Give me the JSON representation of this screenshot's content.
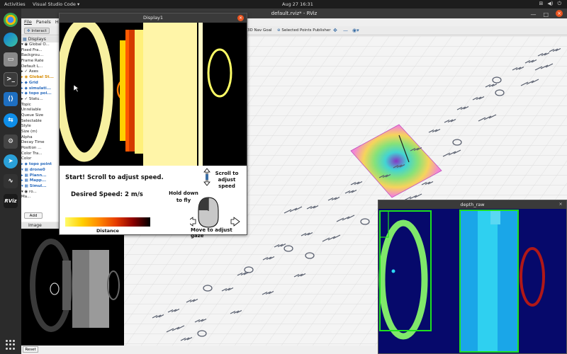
{
  "topbar": {
    "activities": "Activities",
    "app_name": "Visual Studio Code ▾",
    "clock": "Aug 27  16:31",
    "tray_icons": [
      "network-icon",
      "volume-icon",
      "power-icon"
    ]
  },
  "dock": {
    "apps": [
      {
        "name": "chrome",
        "color": "#dd4b39"
      },
      {
        "name": "edge",
        "color": "#1f8bd6"
      },
      {
        "name": "files",
        "color": "#777"
      },
      {
        "name": "terminal",
        "color": "#333"
      },
      {
        "name": "vscode",
        "color": "#1e6fc1"
      },
      {
        "name": "teamviewer",
        "color": "#0e8ee9"
      },
      {
        "name": "settings",
        "color": "#555"
      },
      {
        "name": "telegram",
        "color": "#2aa0d8"
      },
      {
        "name": "monitor",
        "color": "#444"
      },
      {
        "name": "rviz",
        "color": "#222"
      }
    ],
    "badge": "4"
  },
  "rviz": {
    "title": "default.rviz* - RViz",
    "menu": [
      "File",
      "Panels",
      "He"
    ],
    "toolbar": {
      "interact": "Interact",
      "nav_goal": "3D Nav Goal",
      "publish": "Selected Points Publisher"
    },
    "displays": {
      "header": "Displays",
      "rows": [
        {
          "text": "▾ ◉ Global O...",
          "style": "normal"
        },
        {
          "text": "    Fixed Fra...",
          "style": "normal"
        },
        {
          "text": "    Backgrou...",
          "style": "normal"
        },
        {
          "text": "    Frame Rate",
          "style": "normal"
        },
        {
          "text": "    Default L...",
          "style": "normal"
        },
        {
          "text": "▸ ✓ Axes",
          "style": "normal"
        },
        {
          "text": "▸ ◉ Global St...",
          "style": "orange"
        },
        {
          "text": "▸ ◆ Grid",
          "style": "blue"
        },
        {
          "text": "▸ ◆ simulati...",
          "style": "blue"
        },
        {
          "text": "▾ ◆ topo poi...",
          "style": "blue"
        },
        {
          "text": "  ▸ ✓ Statu...",
          "style": "normal"
        },
        {
          "text": "    Topic",
          "style": "normal"
        },
        {
          "text": "    Unreliable",
          "style": "normal"
        },
        {
          "text": "    Queue Size",
          "style": "normal"
        },
        {
          "text": "    Selectable",
          "style": "normal"
        },
        {
          "text": "    Style",
          "style": "normal"
        },
        {
          "text": "    Size (m)",
          "style": "normal"
        },
        {
          "text": "    Alpha",
          "style": "normal"
        },
        {
          "text": "    Decay Time",
          "style": "normal"
        },
        {
          "text": "    Position ...",
          "style": "normal"
        },
        {
          "text": "    Color Tra...",
          "style": "normal"
        },
        {
          "text": "    Color",
          "style": "normal"
        },
        {
          "text": "▸ ◆ topo point",
          "style": "blue"
        },
        {
          "text": "▾ ▦ drone0",
          "style": "blue"
        },
        {
          "text": "  ▸ ▦ Plann...",
          "style": "blue"
        },
        {
          "text": "  ▸ ▦ Mapp...",
          "style": "blue"
        },
        {
          "text": "  ▾ ▦ Simul...",
          "style": "blue"
        },
        {
          "text": "    ▾ ◉ ro...",
          "style": "normal"
        },
        {
          "text": "        Ma...",
          "style": "normal"
        }
      ],
      "add_button": "Add"
    },
    "image_panel": {
      "header": "Image"
    },
    "reset_button": "Reset"
  },
  "display1": {
    "title": "Display1",
    "start_text": "Start! Scroll to adjust speed.",
    "speed_text": "Desired Speed: 2 m/s",
    "scroll_hint": "Scroll to adjust speed",
    "hold_hint": "Hold down to fly",
    "move_hint": "Move to adjust gaze",
    "gradient_label": "Distance"
  },
  "depth_raw": {
    "title": "depth_raw"
  }
}
